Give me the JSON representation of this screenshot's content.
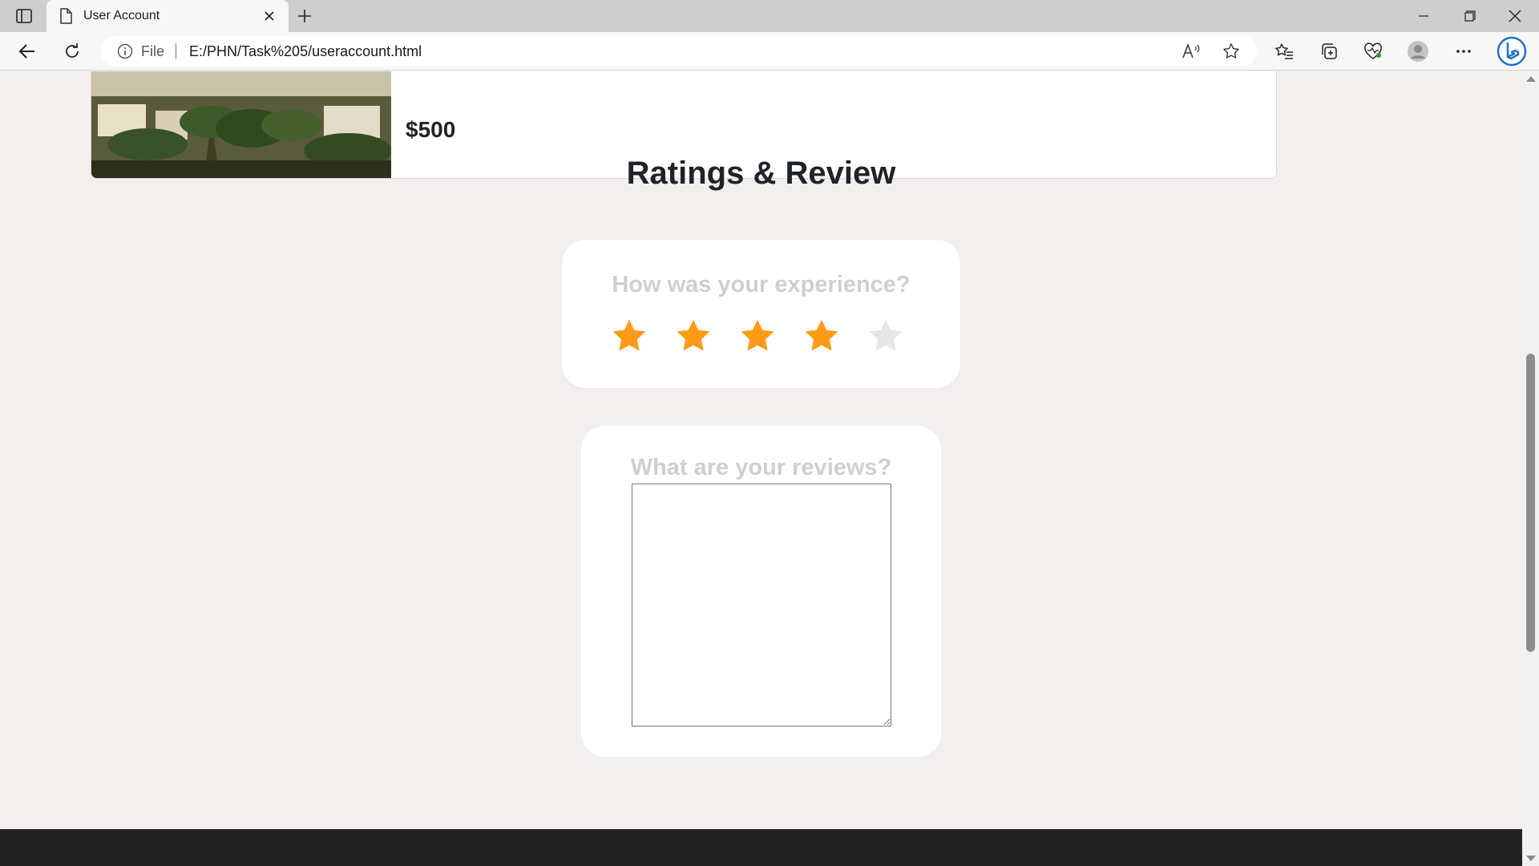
{
  "browser": {
    "tab_title": "User Account",
    "address_label": "File",
    "url": "E:/PHN/Task%205/useraccount.html"
  },
  "booking": {
    "price": "$500"
  },
  "ratings": {
    "title": "Ratings & Review",
    "question": "How was your experience?",
    "rating_value": 4,
    "rating_max": 5,
    "star_active_color": "#ff9a17",
    "star_inactive_color": "#e6e6e8"
  },
  "review": {
    "question": "What are your reviews?",
    "text": ""
  }
}
